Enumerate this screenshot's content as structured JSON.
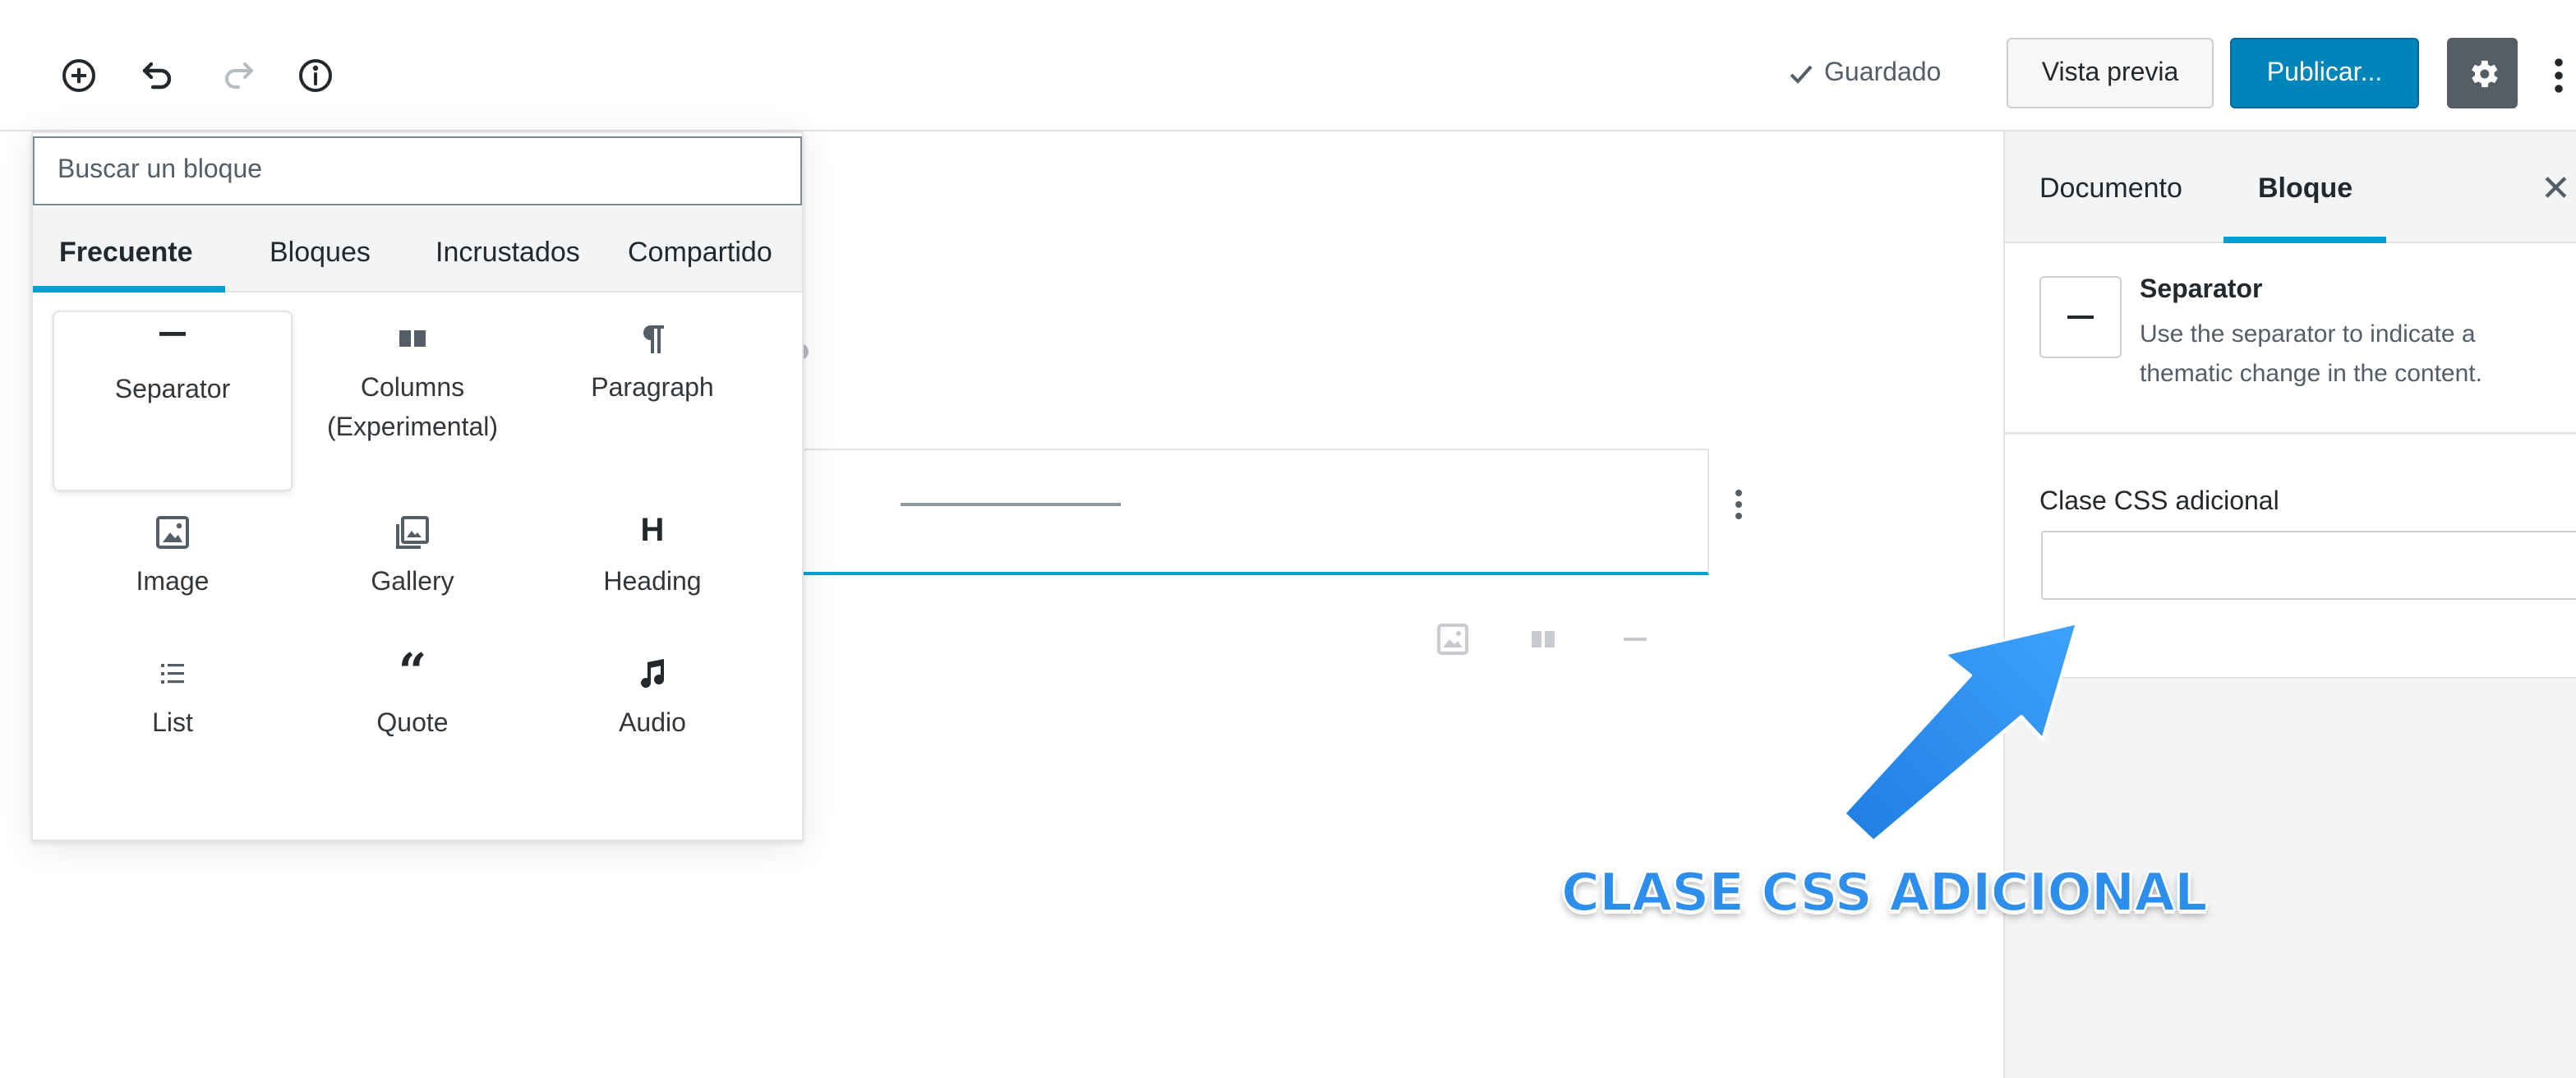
{
  "toolbar": {
    "saved_label": "Guardado",
    "preview_label": "Vista previa",
    "publish_label": "Publicar..."
  },
  "inserter": {
    "search_placeholder": "Buscar un bloque",
    "tabs": [
      "Frecuente",
      "Bloques",
      "Incrustados",
      "Compartido"
    ],
    "active_tab": "Frecuente",
    "items": [
      {
        "label": "Separator",
        "icon": "separator-icon"
      },
      {
        "label": "Columns (Experimental)",
        "icon": "columns-icon"
      },
      {
        "label": "Paragraph",
        "icon": "paragraph-icon"
      },
      {
        "label": "Image",
        "icon": "image-icon"
      },
      {
        "label": "Gallery",
        "icon": "gallery-icon"
      },
      {
        "label": "Heading",
        "icon": "heading-icon"
      },
      {
        "label": "List",
        "icon": "list-icon"
      },
      {
        "label": "Quote",
        "icon": "quote-icon"
      },
      {
        "label": "Audio",
        "icon": "audio-icon"
      }
    ],
    "selected_item": "Separator"
  },
  "sidebar": {
    "tabs": [
      "Documento",
      "Bloque"
    ],
    "active_tab": "Bloque",
    "block_card": {
      "title": "Separator",
      "description": "Use the separator to indicate a thematic change in the content."
    },
    "css_class_label": "Clase CSS adicional",
    "css_class_value": ""
  },
  "annotation": {
    "callout_text": "CLASE CSS ADICIONAL",
    "color": "#2e8eeb"
  },
  "colors": {
    "accent": "#00a0d2",
    "publish": "#0085ba",
    "settings": "#555d66"
  }
}
